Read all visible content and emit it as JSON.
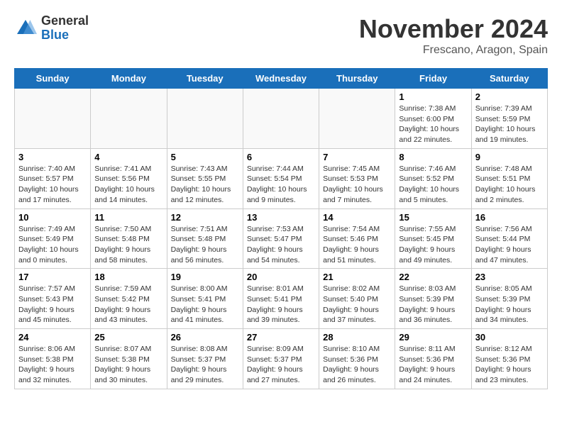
{
  "logo": {
    "general": "General",
    "blue": "Blue"
  },
  "header": {
    "month": "November 2024",
    "location": "Frescano, Aragon, Spain"
  },
  "days_of_week": [
    "Sunday",
    "Monday",
    "Tuesday",
    "Wednesday",
    "Thursday",
    "Friday",
    "Saturday"
  ],
  "weeks": [
    [
      {
        "day": "",
        "info": ""
      },
      {
        "day": "",
        "info": ""
      },
      {
        "day": "",
        "info": ""
      },
      {
        "day": "",
        "info": ""
      },
      {
        "day": "",
        "info": ""
      },
      {
        "day": "1",
        "info": "Sunrise: 7:38 AM\nSunset: 6:00 PM\nDaylight: 10 hours and 22 minutes."
      },
      {
        "day": "2",
        "info": "Sunrise: 7:39 AM\nSunset: 5:59 PM\nDaylight: 10 hours and 19 minutes."
      }
    ],
    [
      {
        "day": "3",
        "info": "Sunrise: 7:40 AM\nSunset: 5:57 PM\nDaylight: 10 hours and 17 minutes."
      },
      {
        "day": "4",
        "info": "Sunrise: 7:41 AM\nSunset: 5:56 PM\nDaylight: 10 hours and 14 minutes."
      },
      {
        "day": "5",
        "info": "Sunrise: 7:43 AM\nSunset: 5:55 PM\nDaylight: 10 hours and 12 minutes."
      },
      {
        "day": "6",
        "info": "Sunrise: 7:44 AM\nSunset: 5:54 PM\nDaylight: 10 hours and 9 minutes."
      },
      {
        "day": "7",
        "info": "Sunrise: 7:45 AM\nSunset: 5:53 PM\nDaylight: 10 hours and 7 minutes."
      },
      {
        "day": "8",
        "info": "Sunrise: 7:46 AM\nSunset: 5:52 PM\nDaylight: 10 hours and 5 minutes."
      },
      {
        "day": "9",
        "info": "Sunrise: 7:48 AM\nSunset: 5:51 PM\nDaylight: 10 hours and 2 minutes."
      }
    ],
    [
      {
        "day": "10",
        "info": "Sunrise: 7:49 AM\nSunset: 5:49 PM\nDaylight: 10 hours and 0 minutes."
      },
      {
        "day": "11",
        "info": "Sunrise: 7:50 AM\nSunset: 5:48 PM\nDaylight: 9 hours and 58 minutes."
      },
      {
        "day": "12",
        "info": "Sunrise: 7:51 AM\nSunset: 5:48 PM\nDaylight: 9 hours and 56 minutes."
      },
      {
        "day": "13",
        "info": "Sunrise: 7:53 AM\nSunset: 5:47 PM\nDaylight: 9 hours and 54 minutes."
      },
      {
        "day": "14",
        "info": "Sunrise: 7:54 AM\nSunset: 5:46 PM\nDaylight: 9 hours and 51 minutes."
      },
      {
        "day": "15",
        "info": "Sunrise: 7:55 AM\nSunset: 5:45 PM\nDaylight: 9 hours and 49 minutes."
      },
      {
        "day": "16",
        "info": "Sunrise: 7:56 AM\nSunset: 5:44 PM\nDaylight: 9 hours and 47 minutes."
      }
    ],
    [
      {
        "day": "17",
        "info": "Sunrise: 7:57 AM\nSunset: 5:43 PM\nDaylight: 9 hours and 45 minutes."
      },
      {
        "day": "18",
        "info": "Sunrise: 7:59 AM\nSunset: 5:42 PM\nDaylight: 9 hours and 43 minutes."
      },
      {
        "day": "19",
        "info": "Sunrise: 8:00 AM\nSunset: 5:41 PM\nDaylight: 9 hours and 41 minutes."
      },
      {
        "day": "20",
        "info": "Sunrise: 8:01 AM\nSunset: 5:41 PM\nDaylight: 9 hours and 39 minutes."
      },
      {
        "day": "21",
        "info": "Sunrise: 8:02 AM\nSunset: 5:40 PM\nDaylight: 9 hours and 37 minutes."
      },
      {
        "day": "22",
        "info": "Sunrise: 8:03 AM\nSunset: 5:39 PM\nDaylight: 9 hours and 36 minutes."
      },
      {
        "day": "23",
        "info": "Sunrise: 8:05 AM\nSunset: 5:39 PM\nDaylight: 9 hours and 34 minutes."
      }
    ],
    [
      {
        "day": "24",
        "info": "Sunrise: 8:06 AM\nSunset: 5:38 PM\nDaylight: 9 hours and 32 minutes."
      },
      {
        "day": "25",
        "info": "Sunrise: 8:07 AM\nSunset: 5:38 PM\nDaylight: 9 hours and 30 minutes."
      },
      {
        "day": "26",
        "info": "Sunrise: 8:08 AM\nSunset: 5:37 PM\nDaylight: 9 hours and 29 minutes."
      },
      {
        "day": "27",
        "info": "Sunrise: 8:09 AM\nSunset: 5:37 PM\nDaylight: 9 hours and 27 minutes."
      },
      {
        "day": "28",
        "info": "Sunrise: 8:10 AM\nSunset: 5:36 PM\nDaylight: 9 hours and 26 minutes."
      },
      {
        "day": "29",
        "info": "Sunrise: 8:11 AM\nSunset: 5:36 PM\nDaylight: 9 hours and 24 minutes."
      },
      {
        "day": "30",
        "info": "Sunrise: 8:12 AM\nSunset: 5:36 PM\nDaylight: 9 hours and 23 minutes."
      }
    ]
  ]
}
